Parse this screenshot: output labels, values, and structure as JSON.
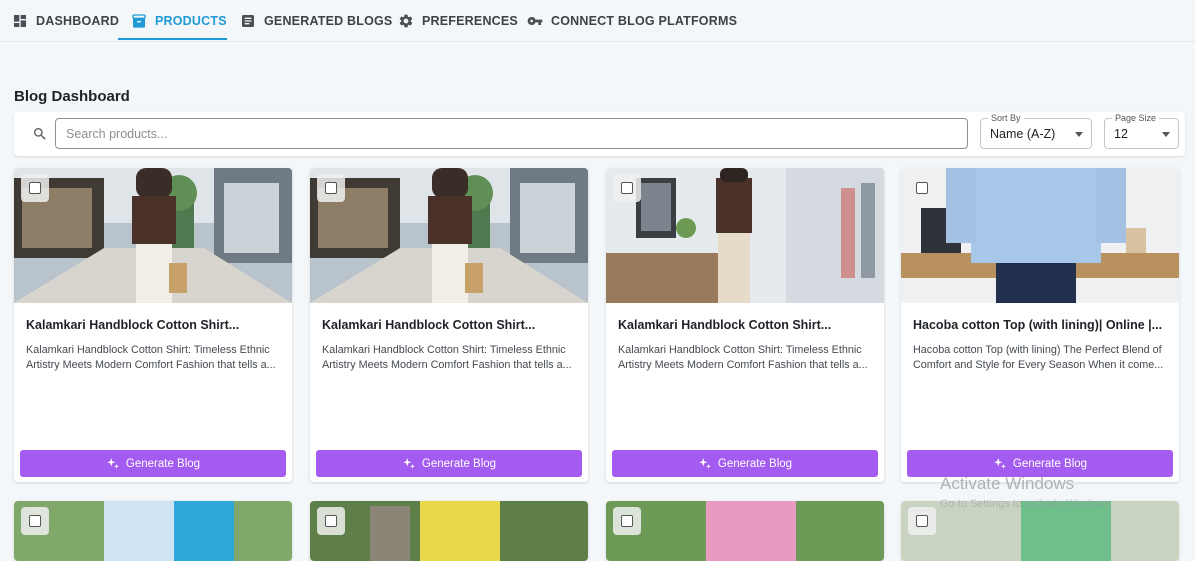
{
  "nav": {
    "tabs": [
      {
        "label": "DASHBOARD",
        "active": false,
        "icon": "dashboard-grid-icon"
      },
      {
        "label": "PRODUCTS",
        "active": true,
        "icon": "inventory-box-icon"
      },
      {
        "label": "GENERATED BLOGS",
        "active": false,
        "icon": "article-icon"
      },
      {
        "label": "PREFERENCES",
        "active": false,
        "icon": "gear-icon"
      },
      {
        "label": "CONNECT BLOG PLATFORMS",
        "active": false,
        "icon": "key-icon"
      }
    ],
    "active_color": "#1e9ad6"
  },
  "page": {
    "title": "Blog Dashboard"
  },
  "toolbar": {
    "search_placeholder": "Search products...",
    "sort": {
      "label": "Sort By",
      "value": "Name (A-Z)"
    },
    "page_size": {
      "label": "Page Size",
      "value": "12"
    }
  },
  "products": [
    {
      "title": "Kalamkari Handblock Cotton Shirt...",
      "description": "Kalamkari Handblock Cotton Shirt: Timeless Ethnic Artistry Meets Modern Comfort Fashion that tells a...",
      "image": "mall-shopping-photo"
    },
    {
      "title": "Kalamkari Handblock Cotton Shirt...",
      "description": "Kalamkari Handblock Cotton Shirt: Timeless Ethnic Artistry Meets Modern Comfort Fashion that tells a...",
      "image": "mall-shopping-photo"
    },
    {
      "title": "Kalamkari Handblock Cotton Shirt...",
      "description": "Kalamkari Handblock Cotton Shirt: Timeless Ethnic Artistry Meets Modern Comfort Fashion that tells a...",
      "image": "office-photo"
    },
    {
      "title": "Hacoba cotton Top (with lining)| Online |...",
      "description": "Hacoba cotton Top (with lining) The Perfect Blend of Comfort and Style for Every Season When it come...",
      "image": "blue-top-office-photo"
    }
  ],
  "generate_label": "Generate Blog",
  "button_color": "#a35bf0",
  "watermark": {
    "title": "Activate Windows",
    "subtitle": "Go to Settings to activate Windows."
  }
}
